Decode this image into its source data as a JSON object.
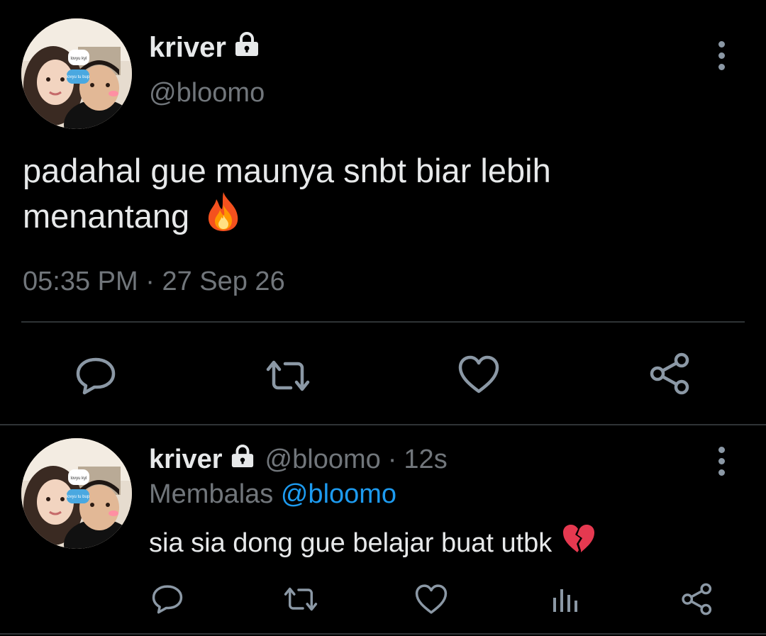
{
  "colors": {
    "background": "#000000",
    "text": "#e7e9ea",
    "muted": "#71767b",
    "icon": "#8b98a5",
    "link": "#1d9bf0",
    "divider": "#2f3336"
  },
  "main_tweet": {
    "display_name": "kriver",
    "handle": "@bloomo",
    "text_line1": "padahal gue maunya snbt biar lebih",
    "text_line2": "menantang",
    "emoji": "fire-emoji",
    "time": "05:35 PM",
    "separator": "·",
    "date": "27 Sep 26",
    "avatar_sticker_1": "lovyu kyl",
    "avatar_sticker_2": "lovyu tu bup",
    "actions": [
      "reply-icon",
      "retweet-icon",
      "like-icon",
      "share-icon"
    ]
  },
  "reply_tweet": {
    "display_name": "kriver",
    "handle": "@bloomo",
    "separator": "·",
    "time_ago": "12s",
    "replying_prefix": "Membalas",
    "replying_to": "@bloomo",
    "text": "sia sia dong gue belajar buat utbk",
    "emoji": "broken-heart-emoji",
    "avatar_sticker_1": "lovyu kyl",
    "avatar_sticker_2": "lovyu tu bup",
    "actions": [
      "reply-icon",
      "retweet-icon",
      "like-icon",
      "analytics-icon",
      "share-icon"
    ]
  }
}
